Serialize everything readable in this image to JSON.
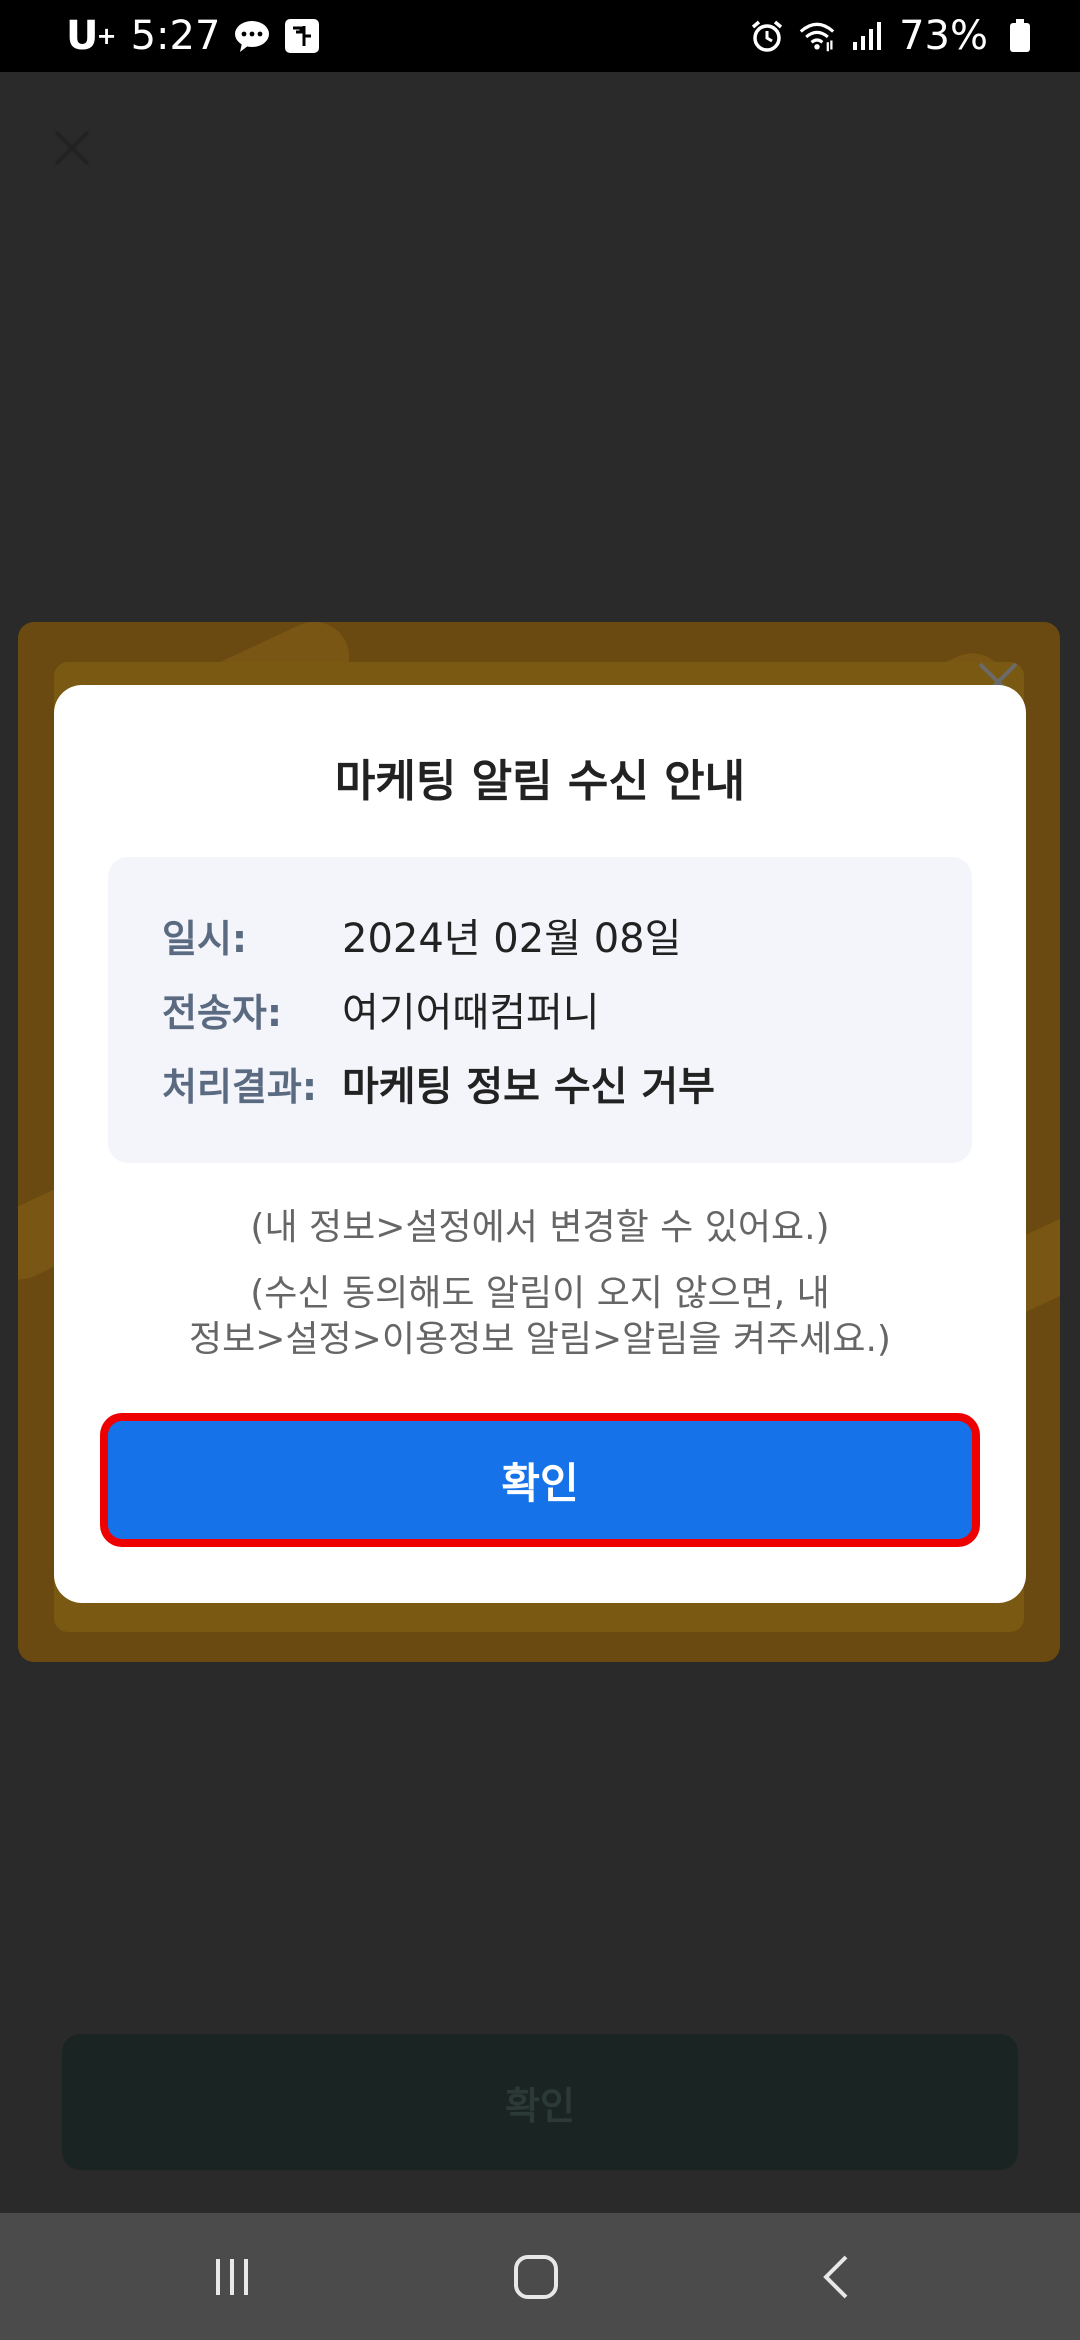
{
  "status_bar": {
    "carrier": "U",
    "carrier_sup": "+",
    "time": "5:27",
    "battery": "73%"
  },
  "background": {
    "confirm_label": "확인"
  },
  "modal": {
    "title": "마케팅 알림 수신 안내",
    "rows": [
      {
        "label": "일시:",
        "value": "2024년 02월 08일"
      },
      {
        "label": "전송자:",
        "value": "여기어때컴퍼니"
      },
      {
        "label": "처리결과:",
        "value": "마케팅 정보 수신 거부"
      }
    ],
    "note1": "(내 정보>설정에서 변경할 수 있어요.)",
    "note2_line1": "(수신 동의해도 알림이 오지 않으면, 내",
    "note2_line2": "정보>설정>이용정보 알림>알림을 켜주세요.)",
    "confirm_label": "확인"
  },
  "colors": {
    "primary_button": "#1672e8",
    "highlight_border": "#ee0000"
  }
}
